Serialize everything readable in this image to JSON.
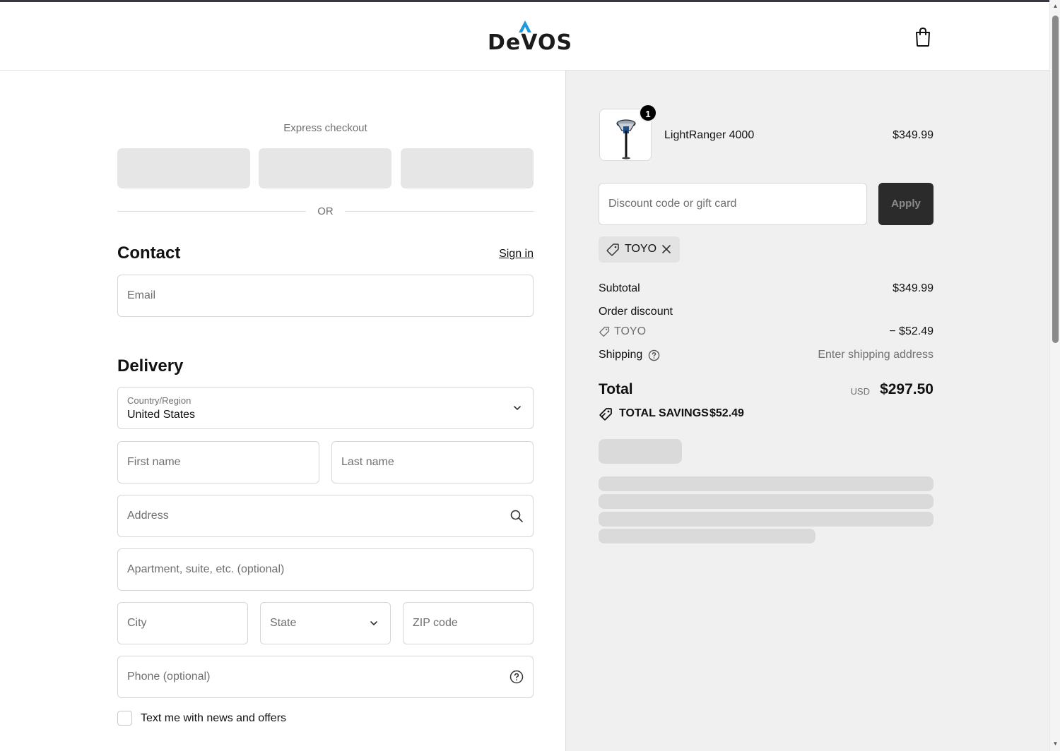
{
  "brand": {
    "logo_text": "DeVOS"
  },
  "express": {
    "title": "Express checkout",
    "or_text": "OR"
  },
  "contact": {
    "title": "Contact",
    "sign_in": "Sign in",
    "email_placeholder": "Email"
  },
  "delivery": {
    "title": "Delivery",
    "country_label": "Country/Region",
    "country_value": "United States",
    "first_name_placeholder": "First name",
    "last_name_placeholder": "Last name",
    "address_placeholder": "Address",
    "apartment_placeholder": "Apartment, suite, etc. (optional)",
    "city_placeholder": "City",
    "state_placeholder": "State",
    "zip_placeholder": "ZIP code",
    "phone_placeholder": "Phone (optional)",
    "sms_optin_label": "Text me with news and offers"
  },
  "summary": {
    "product": {
      "name": "LightRanger 4000",
      "price": "$349.99",
      "quantity": "1"
    },
    "discount_placeholder": "Discount code or gift card",
    "apply_label": "Apply",
    "applied_code": "TOYO",
    "subtotal_label": "Subtotal",
    "subtotal_value": "$349.99",
    "order_discount_label": "Order discount",
    "order_discount_code": "TOYO",
    "order_discount_value": "− $52.49",
    "shipping_label": "Shipping",
    "shipping_value": "Enter shipping address",
    "total_label": "Total",
    "total_currency": "USD",
    "total_value": "$297.50",
    "savings_label": "TOTAL SAVINGS",
    "savings_value": "$52.49"
  },
  "colors": {
    "accent_logo": "#1e9be0",
    "apply_bg": "#2b2b2b",
    "panel_bg": "#f0f0f0"
  }
}
